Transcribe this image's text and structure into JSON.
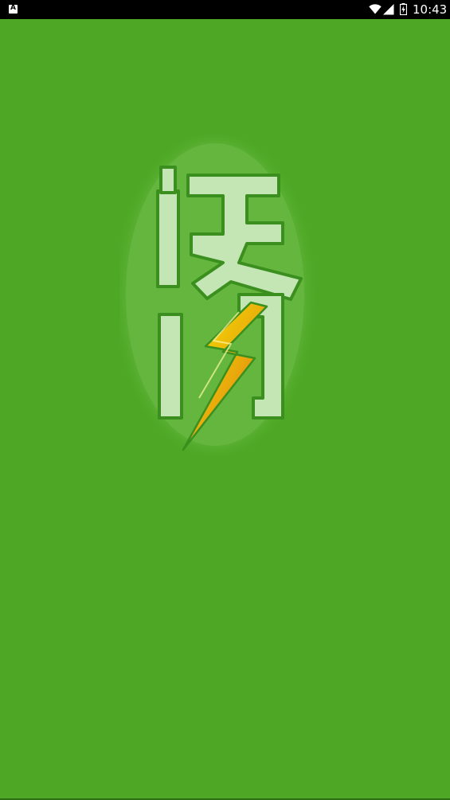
{
  "status_bar": {
    "time": "10:43",
    "notification_icon": "app-notification-icon",
    "wifi_icon": "wifi-icon",
    "signal_icon": "cell-signal-icon",
    "battery_icon": "battery-charging-icon"
  },
  "splash": {
    "logo_text": "快马",
    "logo_icon": "lightning-logo-icon",
    "colors": {
      "background": "#4ea825",
      "logo_fill": "#c3e6b4",
      "logo_outline": "#3b8f1e",
      "bolt_yellow": "#f2e000",
      "bolt_orange": "#e46a12"
    }
  }
}
